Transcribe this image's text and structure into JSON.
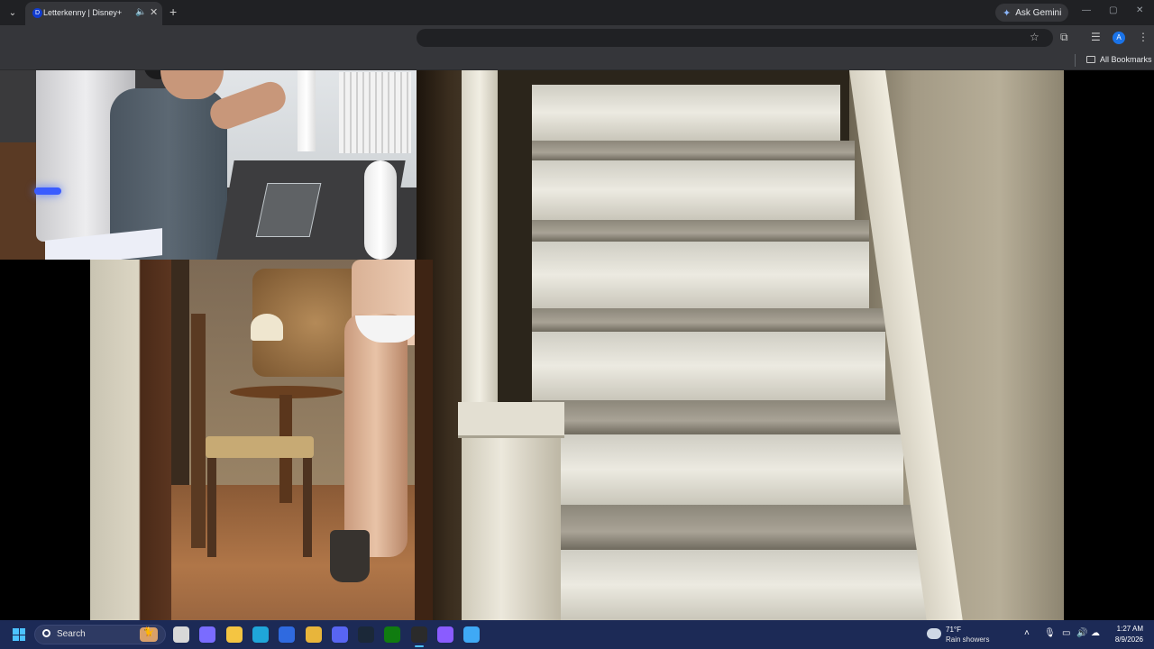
{
  "browser": {
    "tab_title": "Letterkenny | Disney+",
    "tab_favicon_letter": "D",
    "new_tab_label": "+",
    "ask_gemini_label": "Ask Gemini",
    "profile_initial": "A",
    "bookmarks_label": "All Bookmarks",
    "window_controls": {
      "minimize": "—",
      "maximize": "▢",
      "close": "✕"
    }
  },
  "icons": {
    "tab_search": "chevron-down-icon",
    "audio": "speaker-icon",
    "close": "close-icon",
    "star": "star-icon",
    "extensions": "puzzle-icon",
    "reading_list": "reading-list-icon",
    "menu": "kebab-menu-icon",
    "folder": "folder-icon"
  },
  "taskbar": {
    "search_placeholder": "Search",
    "weather": {
      "temp": "71°F",
      "desc": "Rain showers"
    },
    "clock": {
      "time": "1:27 AM",
      "date": "8/9/2026"
    },
    "apps": [
      {
        "name": "task-view",
        "color": "#d8d8d8"
      },
      {
        "name": "copilot",
        "color": "#7a6cff"
      },
      {
        "name": "file-explorer",
        "color": "#f4c542"
      },
      {
        "name": "edge",
        "color": "#1fa6d9"
      },
      {
        "name": "app-blue",
        "color": "#2f6ae0"
      },
      {
        "name": "chrome",
        "color": "#e8b53b"
      },
      {
        "name": "discord",
        "color": "#5865f2"
      },
      {
        "name": "steam",
        "color": "#1b2838"
      },
      {
        "name": "xbox",
        "color": "#107c10"
      },
      {
        "name": "obs",
        "color": "#2b2b2b"
      },
      {
        "name": "app-grid",
        "color": "#8a5cff"
      },
      {
        "name": "app-diamond",
        "color": "#3fa9f5"
      }
    ]
  },
  "colors": {
    "chrome_dark": "#202124",
    "chrome_toolbar": "#35363a",
    "taskbar": "#1c2a56",
    "accent": "#4cc2ff"
  }
}
